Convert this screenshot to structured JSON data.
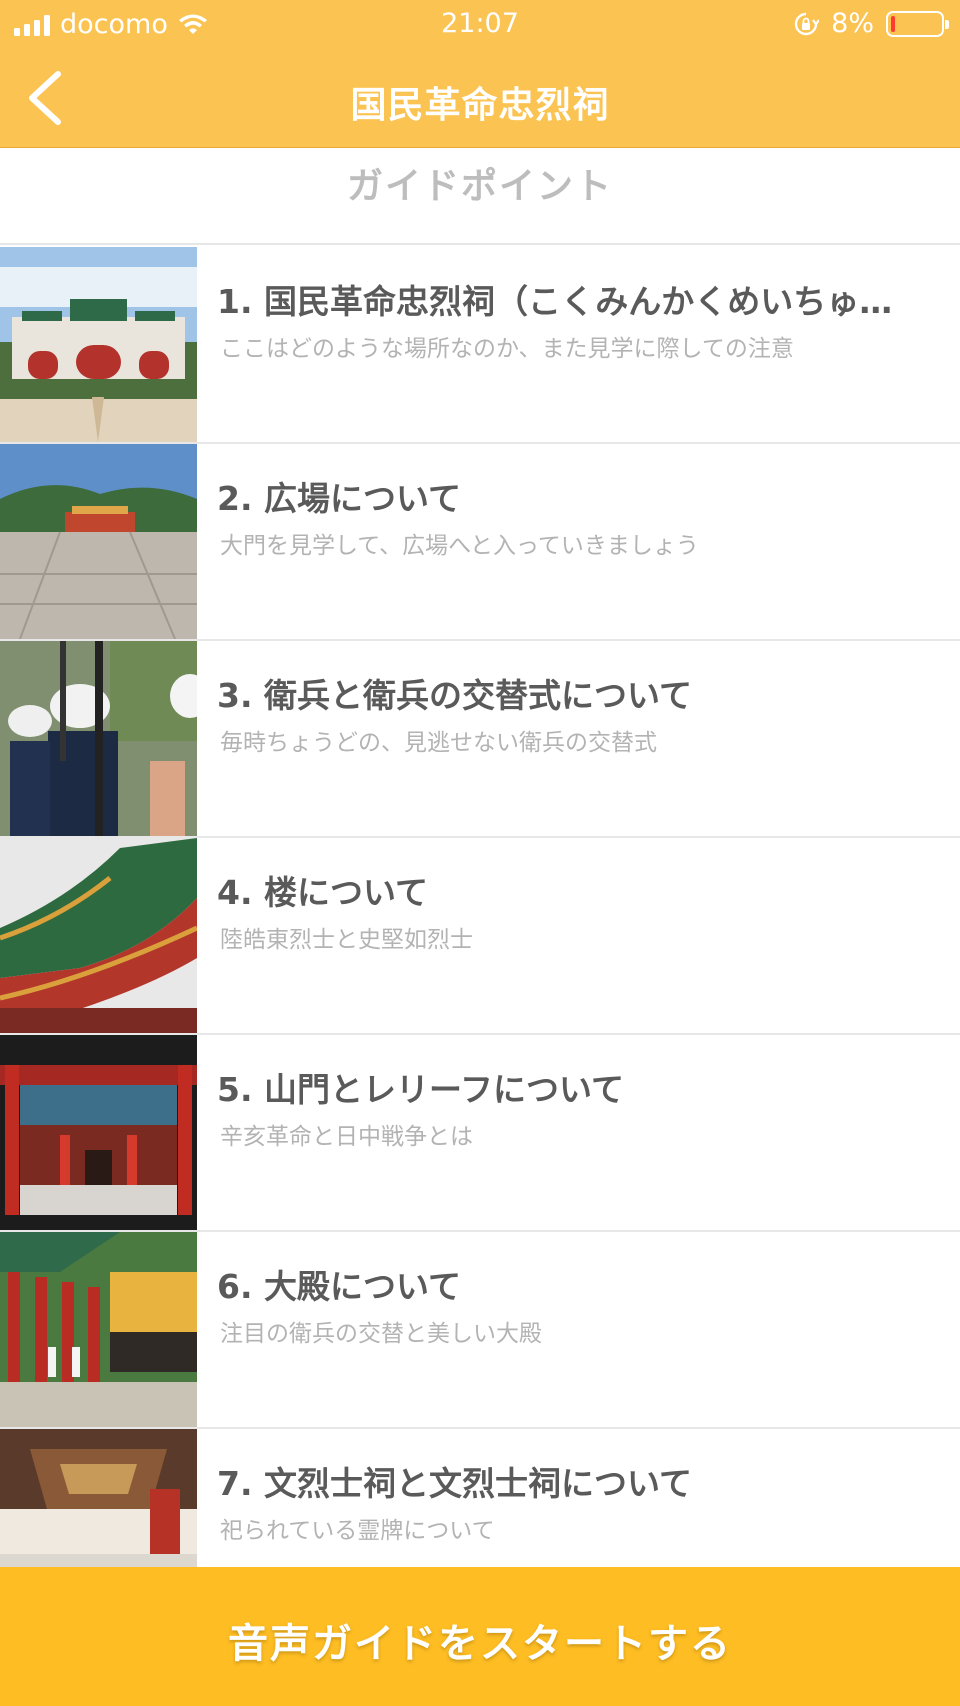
{
  "status_bar": {
    "carrier": "docomo",
    "time": "21:07",
    "battery": "8%",
    "battery_level": 0.08,
    "icons": [
      "signal-icon",
      "wifi-icon",
      "orientation-lock-icon",
      "battery-icon"
    ]
  },
  "nav": {
    "title": "国民革命忠烈祠",
    "back_icon": "chevron-left-icon"
  },
  "section": {
    "title": "ガイドポイント"
  },
  "guide_points": [
    {
      "title": "1. 国民革命忠烈祠（こくみんかくめいちゅ…",
      "subtitle": "ここはどのような場所なのか、また見学に際しての注意"
    },
    {
      "title": "2. 広場について",
      "subtitle": "大門を見学して、広場へと入っていきましょう"
    },
    {
      "title": "3. 衛兵と衛兵の交替式について",
      "subtitle": "毎時ちょうどの、見逃せない衛兵の交替式"
    },
    {
      "title": "4. 楼について",
      "subtitle": "陸皓東烈士と史堅如烈士"
    },
    {
      "title": "5. 山門とレリーフについて",
      "subtitle": "辛亥革命と日中戦争とは"
    },
    {
      "title": "6. 大殿について",
      "subtitle": "注目の衛兵の交替と美しい大殿"
    },
    {
      "title": "7. 文烈士祠と文烈士祠について",
      "subtitle": "祀られている霊牌について"
    }
  ],
  "start_button": {
    "label": "音声ガイドをスタートする"
  },
  "colors": {
    "header": "#fbc352",
    "button": "#fdbd23",
    "title_text": "#5a5a5a",
    "subtitle_text": "#b3b3b3"
  }
}
